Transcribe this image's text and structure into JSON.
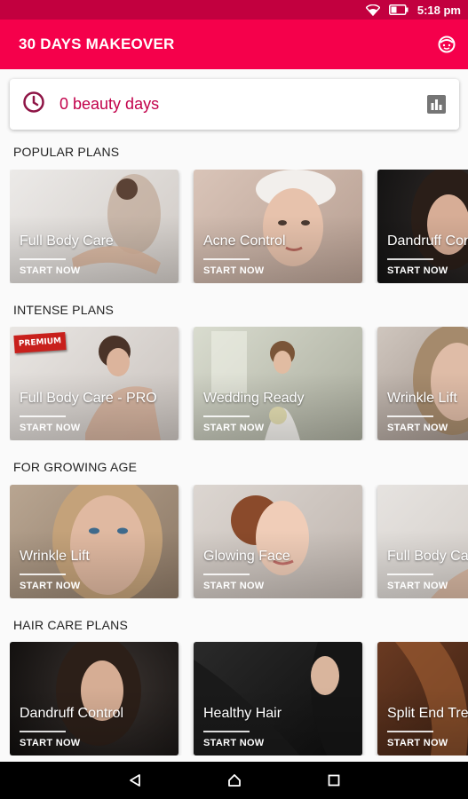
{
  "status_bar": {
    "time": "5:18 pm",
    "icons": [
      "wifi-icon",
      "battery-icon"
    ]
  },
  "app_bar": {
    "title": "30 DAYS MAKEOVER",
    "action_icon": "face-icon"
  },
  "days_card": {
    "icon": "clock-icon",
    "text": "0 beauty days",
    "action_icon": "bar-chart-icon"
  },
  "sections": [
    {
      "title": "POPULAR PLANS",
      "cards": [
        {
          "title": "Full Body Care",
          "cta": "START NOW"
        },
        {
          "title": "Acne Control",
          "cta": "START NOW"
        },
        {
          "title": "Dandruff Control",
          "cta": "START NOW"
        }
      ]
    },
    {
      "title": "INTENSE PLANS",
      "cards": [
        {
          "title": "Full Body Care - PRO",
          "cta": "START NOW",
          "badge": "PREMIUM"
        },
        {
          "title": "Wedding Ready",
          "cta": "START NOW"
        },
        {
          "title": "Wrinkle Lift",
          "cta": "START NOW"
        }
      ]
    },
    {
      "title": "FOR GROWING AGE",
      "cards": [
        {
          "title": "Wrinkle Lift",
          "cta": "START NOW"
        },
        {
          "title": "Glowing Face",
          "cta": "START NOW"
        },
        {
          "title": "Full Body Care",
          "cta": "START NOW"
        }
      ]
    },
    {
      "title": "HAIR CARE PLANS",
      "cards": [
        {
          "title": "Dandruff Control",
          "cta": "START NOW"
        },
        {
          "title": "Healthy Hair",
          "cta": "START NOW"
        },
        {
          "title": "Split End Treatment",
          "cta": "START NOW"
        }
      ]
    }
  ],
  "nav_bar": {
    "icons": [
      "back-icon",
      "home-icon",
      "recents-icon"
    ]
  },
  "colors": {
    "primary": "#f5004b",
    "primary_dark": "#c2003f",
    "accent_text": "#c2004a"
  }
}
